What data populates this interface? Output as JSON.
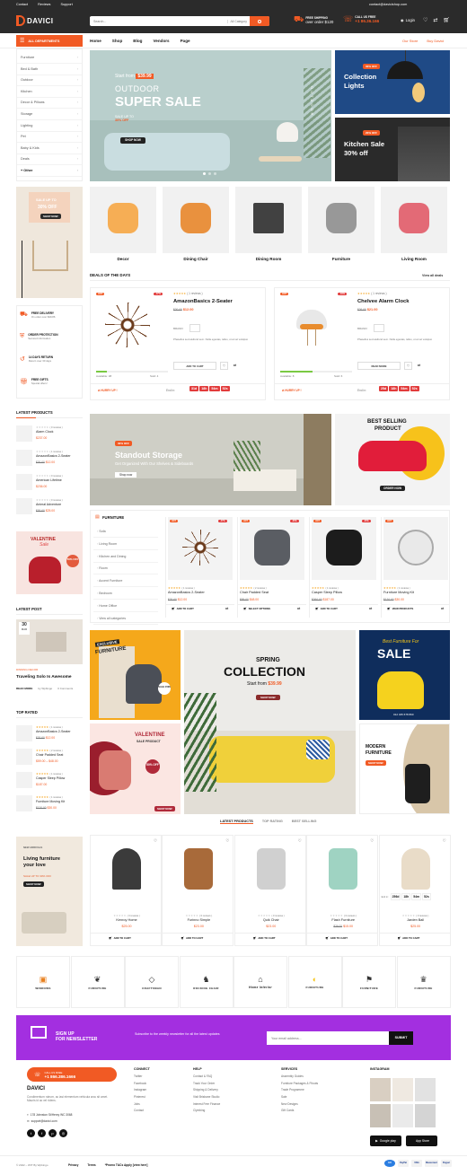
{
  "topbar": {
    "links": [
      "Contact",
      "Reviews",
      "Support"
    ],
    "email": "contact@davicishop.com"
  },
  "header": {
    "logo": "DAVICI",
    "search_placeholder": "Search...",
    "category": "All Category",
    "shipping_title": "FREE SHIPPING",
    "shipping_sub": "over order $120",
    "call_title": "CALL US FREE",
    "call_number": "+1 86.36.166",
    "login": "Login",
    "cart_count": "0",
    "wish_count": "0",
    "compare_count": "0"
  },
  "nav": {
    "departments": "ALL DEPARTMENTS",
    "items": [
      "Home",
      "Shop",
      "Blog",
      "Vendors",
      "Page"
    ],
    "right": [
      "Our Store",
      "Buy Davici"
    ]
  },
  "departments": [
    "Furniture",
    "Bed & Bath",
    "Outdoor",
    "Kitchen",
    "Decor & Pillows",
    "Storage",
    "Lighting",
    "Pet",
    "Baby & Kids",
    "Deals",
    "+ Other"
  ],
  "hero": {
    "price_line": "Start from",
    "price": "$39.99",
    "title1": "OUTDOOR",
    "title2": "SUPER SALE",
    "sale": "SALE UP TO",
    "sale2": "30% OFF",
    "btn": "SHOP NOW",
    "side": "OUTDOOR"
  },
  "banner_lights": {
    "badge": "30% OFF",
    "title1": "Collection",
    "title2": "Lights"
  },
  "banner_kitchen": {
    "badge": "20% OFF",
    "title1": "Kitchen Sale",
    "title2": "30% off"
  },
  "left_promo": {
    "l1": "SALE UP TO",
    "l2": "30% OFF",
    "btn": "SHOP NOW"
  },
  "categories": [
    "Decor",
    "Dining Chair",
    "Dining Room",
    "Furniture",
    "Living Room"
  ],
  "features": [
    {
      "t": "FREE DELIVERY",
      "s": "On order over $49.86"
    },
    {
      "t": "ORDER PROTECTION",
      "s": "Secured information"
    },
    {
      "t": "14 DAYS RETURN",
      "s": "Return over 30 days"
    },
    {
      "t": "FREE GIFTS",
      "s": "Special offers!"
    }
  ],
  "deals": {
    "title": "DEALS OF THE DAYS",
    "view_all": "View all deals",
    "items": [
      {
        "hot": "HOT",
        "disc": "-47%",
        "reviews": "( 1 reviews )",
        "name": "AmazonBasics 2-Seater",
        "old": "$20.00",
        "price": "$12.00",
        "brand": "BRAND:",
        "desc": "Phasellus sed eleifend sem. Nulla egestas, tellus, ut at vel volutpat.",
        "available": "Available: 38",
        "sold": "Sold: 4",
        "add": "ADD TO CART",
        "hurry": "HURRY UP !",
        "end": "End in:",
        "timer": [
          "31d",
          "18h",
          "54m",
          "52s"
        ]
      },
      {
        "hot": "HOT",
        "disc": "-19%",
        "reviews": "( 1 reviews )",
        "name": "Chelvee Alarm Clock",
        "old": "$26.00",
        "price": "$21.00",
        "brand": "BRAND:",
        "desc": "Phasellus sed eleifend sem. Nulla egestas, tellus, ut at vel volutpat.",
        "available": "Available: 8",
        "sold": "Sold: 6",
        "add": "READ MORE",
        "hurry": "HURRY UP !",
        "end": "End in:",
        "timer": [
          "25d",
          "18h",
          "54m",
          "52s"
        ]
      }
    ]
  },
  "latest_products": {
    "title": "LATEST PRODUCTS",
    "items": [
      {
        "r": "( 0 reviews )",
        "n": "Alarm Clock",
        "p": "$237.00"
      },
      {
        "r": "( 1 reviews )",
        "n": "AmazonBasics 2-Seater",
        "o": "$20.00",
        "p": "$12.00"
      },
      {
        "r": "( 0 reviews )",
        "n": "American Lifetime",
        "p": "$236.00"
      },
      {
        "r": "( 0 reviews )",
        "n": "Animal Adventure",
        "o": "$30.00",
        "p": "$25.00"
      }
    ]
  },
  "valentine_left": {
    "t1": "VALENTINE",
    "t2": "Sale",
    "pct": "50% OFF"
  },
  "storage": {
    "badge": "30% OFF",
    "t1": "Standout Storage",
    "t2": "Get Organized With Our Shelves & Sideboards",
    "btn": "Shop now"
  },
  "best_selling": {
    "t1": "BEST SELLING",
    "t2": "PRODUCT",
    "btn": "ORDER NOW"
  },
  "furniture": {
    "title": "FURNITURE",
    "cats": [
      "Sofa",
      "Living Room",
      "Kitchen and Dining",
      "Room",
      "Accent Furniture",
      "Bedroom",
      "Home Office",
      "View all categories"
    ],
    "items": [
      {
        "hot": "HOT",
        "disc": "-47%",
        "n": "AmazonBasics 2-Seater",
        "r": "( 1 reviews )",
        "o": "$20.00",
        "p": "$12.00",
        "a": "ADD TO CART"
      },
      {
        "hot": "HOT",
        "disc": "-30%",
        "n": "Chair Padded Seat",
        "r": "( 2 reviews )",
        "o": "$59.00",
        "p": "$48.00",
        "a": "SELECT OPTIONS"
      },
      {
        "hot": "HOT",
        "disc": "-30%",
        "n": "Casper Sleep Pillow",
        "r": "( 1 reviews )",
        "o": "$260.00",
        "p": "$187.00",
        "a": "ADD TO CART"
      },
      {
        "hot": "HOT",
        "disc": "",
        "n": "Furniture Moving Kit",
        "r": "( 1 reviews )",
        "o": "$120.00",
        "p": "$30.00",
        "a": "VIEW PRODUCTS"
      }
    ]
  },
  "latest_post": {
    "title": "LATEST POST",
    "day": "30",
    "month": "MAR",
    "cat": "DINNING DECOR",
    "name": "Traveling Solo Is Awesome",
    "more": "READ MORE",
    "by": "by Wpbingo",
    "comments": "0 Comments"
  },
  "top_rated": {
    "title": "TOP RATED",
    "items": [
      {
        "r": "( 1 reviews )",
        "n": "AmazonBasics 2-Seater",
        "o": "$20.00",
        "p": "$12.00"
      },
      {
        "r": "( 2 reviews )",
        "n": "Chair Padded Seat",
        "p": "$59.00 – $48.00"
      },
      {
        "r": "( 1 reviews )",
        "n": "Casper Sleep Pillow",
        "p": "$187.00"
      },
      {
        "r": "( 1 reviews )",
        "n": "Furniture Moving Kit",
        "o": "$120.00",
        "p": "$30.00"
      }
    ]
  },
  "grid_banners": {
    "exclusive1": "EXCLUSIVE",
    "exclusive2": "FURNITURE",
    "spring1": "SPRING",
    "spring2": "COLLECTION",
    "spring_price_line": "Start from",
    "spring_price": "$39.99",
    "spring_btn": "SHOP NOW",
    "best1": "Best Furniture For",
    "best2": "SALE",
    "valentine1": "VALENTINE",
    "valentine2": "SALE PRODUCT",
    "val_pct": "50% OFF",
    "val_btn": "SHOP NOW",
    "modern1": "MODERN",
    "modern2": "FURNITURE",
    "modern_btn": "SHOP NOW",
    "phone": "012 345 678 890",
    "seal": "SALE 150$"
  },
  "tabs": [
    "LATEST PRODUCTS",
    "TOP RATING",
    "BEST SELLING"
  ],
  "living_banner": {
    "tag": "NEW ARRIVALS",
    "t": "Living furniture your love",
    "sale": "SALE UP TO 30% OFF",
    "btn": "SHOP NOW"
  },
  "tab_products": [
    {
      "n": "Kenroy Home",
      "p": "$25.00",
      "a": "ADD TO CART",
      "r": "( 0 reviews )"
    },
    {
      "n": "Furinno Simple",
      "p": "$23.00",
      "a": "ADD TO CART",
      "r": "( 0 reviews )"
    },
    {
      "n": "Quik Chair",
      "p": "$23.00",
      "a": "ADD TO CART",
      "r": "( 0 reviews )"
    },
    {
      "n": "Flash Furniture",
      "o": "$26.00",
      "p": "$15.00",
      "a": "ADD TO CART",
      "r": "( 0 reviews )"
    },
    {
      "n": "Jarden Ball",
      "p": "$25.00",
      "a": "ADD TO CART",
      "r": "( 0 reviews )",
      "end": "End in:",
      "timer": [
        "256d",
        "18h",
        "54m",
        "52s"
      ]
    }
  ],
  "brands": [
    "WINDOWS",
    "FURNITURE",
    "CRAFTSMAN",
    "ROCKING CHAIR",
    "Home Interior",
    "FURNITURE",
    "FURNITURE",
    "FURNITURE"
  ],
  "newsletter": {
    "t1": "SIGN UP",
    "t2": "FOR NEWSLETTER",
    "desc": "Subscribe to the weekly newsletter for all the latest updates",
    "placeholder": "Your email address...",
    "btn": "SUBMIT"
  },
  "footer": {
    "call": "CALL US FREE",
    "number": "+1 866.386.1666",
    "logo": "DAVICI",
    "about": "Condimentum rutrum, ac iasi elementum vehicula arcu sit amet. Mauris id ac vel ridens.",
    "address": "178 Johnston St/Henry WC 3068",
    "email": "support@davici.com",
    "cols": [
      {
        "h": "CONNECT",
        "items": [
          "Twitter",
          "Facebook",
          "Instagram",
          "Pinterest",
          "Jobs",
          "Contact"
        ]
      },
      {
        "h": "HELP",
        "items": [
          "Contact & FAQ",
          "Track Your Order",
          "Shipping & Delivery",
          "Visit Brisbane Studio",
          "Interest Free Finance",
          "Clymbing"
        ]
      },
      {
        "h": "SERVICES",
        "items": [
          "Assembly Guides",
          "Furniture Packages & Fitouts",
          "Trade Programme",
          "Sale",
          "New Designs",
          "Gift Cards"
        ]
      }
    ],
    "instagram": "INSTAGRAM",
    "copy": "© 2022 – WIT By Wpbingo",
    "legal": [
      "Privacy",
      "Terms"
    ],
    "promo": "*Promo T&Cs Apply [view here]",
    "pay": [
      "GO",
      "PayPal",
      "VISA",
      "Mastercard",
      "Paypal"
    ],
    "store1": "Google play",
    "store2": "App Store"
  },
  "colors": {
    "accent": "#f15a24",
    "dark": "#2b2b2b",
    "purple": "#a32fe0"
  }
}
